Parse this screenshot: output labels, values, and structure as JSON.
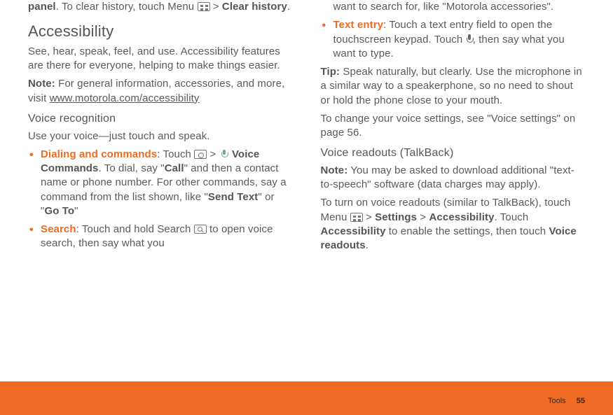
{
  "left": {
    "intro_pre": "panel",
    "intro_mid": ". To clear history, touch Menu ",
    "intro_gt": " > ",
    "intro_bold": "Clear history",
    "intro_end": ".",
    "h_access": "Accessibility",
    "access_p": "See, hear, speak, feel, and use. Accessibility features are there for everyone, helping to make things easier.",
    "note_label": "Note:",
    "note_text": " For general information, accessories, and more, visit ",
    "note_link": "www.motorola.com/accessibility",
    "h_voice": "Voice recognition",
    "voice_p": "Use your voice—just touch and speak.",
    "b1_title": "Dialing and commands",
    "b1_colon": ": Touch ",
    "b1_gt": " > ",
    "b1_vc": " Voice Commands",
    "b1_after": ". To dial, say \"",
    "b1_call": "Call",
    "b1_mid": "\" and then a contact name or phone number. For other commands, say a command from the list shown, like \"",
    "b1_send": "Send Text",
    "b1_or": "\" or \"",
    "b1_goto": "Go To",
    "b1_end": "\"",
    "b2_title": "Search",
    "b2_colon": ": Touch and hold Search ",
    "b2_after": " to open voice search, then say what you"
  },
  "right": {
    "cont": "want to search for, like \"Motorola accessories\".",
    "b3_title": "Text entry",
    "b3_colon": ": Touch a text entry field to open the touchscreen keypad. Touch ",
    "b3_after": ", then say what you want to type.",
    "tip_label": "Tip:",
    "tip_text": " Speak naturally, but clearly. Use the microphone in a similar way to a speakerphone, so no need to shout or hold the phone close to your mouth.",
    "change_p": "To change your voice settings, see \"Voice settings\" on page 56.",
    "h_read": "Voice readouts (TalkBack)",
    "note2_label": "Note:",
    "note2_text": " You may be asked to download additional \"text-to-speech\" software (data charges may apply).",
    "turn_pre": "To turn on voice readouts (similar to TalkBack), touch Menu ",
    "turn_gt": " > ",
    "turn_settings": "Settings",
    "turn_gt2": " > ",
    "turn_access": "Accessibility",
    "turn_mid": ". Touch ",
    "turn_access2": "Accessibility",
    "turn_after": " to enable the settings, then touch ",
    "turn_vr": "Voice readouts",
    "turn_end": "."
  },
  "footer": {
    "section": "Tools",
    "page": "55"
  }
}
